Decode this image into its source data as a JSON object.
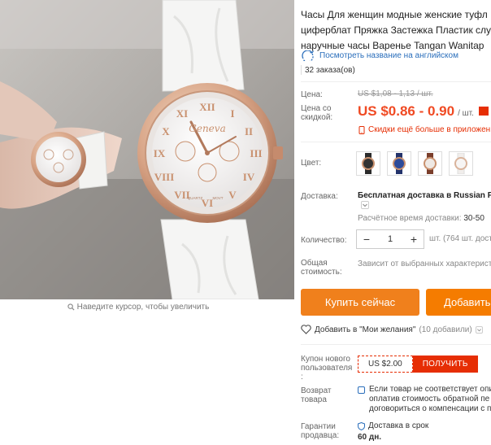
{
  "gallery": {
    "zoom_hint": "Наведите курсор, чтобы увеличить",
    "watch_brand": "Geneva",
    "dial_label_quartz": "QUARTZ",
    "dial_label_movt": "MOVT"
  },
  "product": {
    "title_lines": [
      "Часы Для женщин модные женские туфл",
      "циферблат Пряжка Застежка Пластик слу",
      "наручные часы Варенье Tangan Wanitap"
    ],
    "translate_link": "Посмотреть название на английском",
    "orders": "32 заказа(ов)"
  },
  "price": {
    "label": "Цена:",
    "old": "US $1,08 - 1,13 / шт.",
    "discount_label_line1": "Цена со",
    "discount_label_line2": "скидкой:",
    "value": "US $0.86 - 0.90",
    "unit": "/ шт.",
    "promo": "Скидки ещё больше в приложен"
  },
  "color": {
    "label": "Цвет:",
    "swatches": [
      "black",
      "blue",
      "brown",
      "white"
    ]
  },
  "shipping": {
    "label": "Доставка:",
    "title": "Бесплатная доставка в Russian Fe",
    "time_label": "Расчётное время доставки:",
    "time_value": "30-50 "
  },
  "quantity": {
    "label": "Количество:",
    "minus": "−",
    "value": "1",
    "plus": "+",
    "stock": "шт. (764 шт. доступно)"
  },
  "total": {
    "label_line1": "Общая",
    "label_line2": "стоимость:",
    "note": "Зависит от выбранных характеристи"
  },
  "actions": {
    "buy": "Купить сейчас",
    "cart": "Добавить"
  },
  "wishlist": {
    "text": "Добавить в \"Мои желания\"",
    "count": "(10 добавили)"
  },
  "coupon": {
    "label_line1": "Купон нового",
    "label_line2": "пользователя",
    "label_line3": ":",
    "amount": "US $2.00",
    "button": "ПОЛУЧИТЬ"
  },
  "returns": {
    "label_line1": "Возврат",
    "label_line2": "товара",
    "lines": [
      "Если товар не соответствует опи",
      "оплатив стоимость обратной пе",
      "договориться о компенсации с п"
    ]
  },
  "guarantee": {
    "label_line1": "Гарантии",
    "label_line2": "продавца:",
    "text": "Доставка в срок",
    "days": "60 дн."
  },
  "colors": {
    "price": "#f04a23",
    "buy_button": "#f0801c",
    "cart_button": "#f57c00",
    "coupon": "#e62e04",
    "link": "#2a6ebb"
  }
}
